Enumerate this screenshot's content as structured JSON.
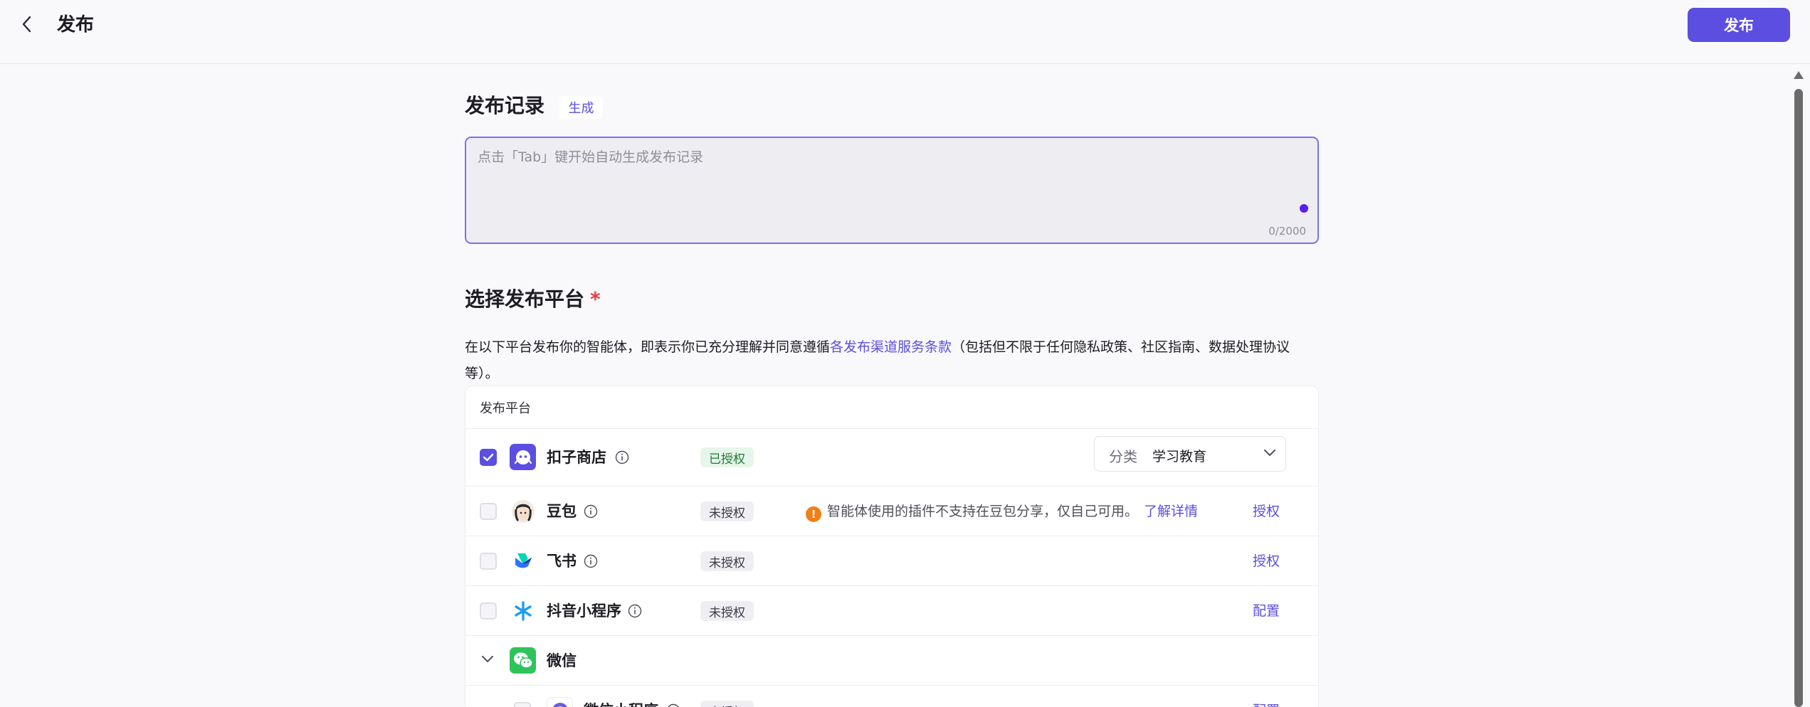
{
  "header": {
    "title": "发布",
    "publish_label": "发布"
  },
  "record": {
    "title": "发布记录",
    "generate_label": "生成",
    "placeholder": "点击「Tab」键开始自动生成发布记录",
    "counter": "0/2000"
  },
  "platform_section": {
    "title": "选择发布平台",
    "required": "*",
    "desc_before": "在以下平台发布你的智能体，即表示你已充分理解并同意遵循",
    "desc_link": "各发布渠道服务条款",
    "desc_after": "（包括但不限于任何隐私政策、社区指南、数据处理协议等）。"
  },
  "table": {
    "header": "发布平台",
    "rows": [
      {
        "name": "扣子商店",
        "status": "已授权",
        "checked": true,
        "icon": "coze-store-icon",
        "category_label": "分类",
        "category_value": "学习教育"
      },
      {
        "name": "豆包",
        "status": "未授权",
        "checked": false,
        "icon": "doubao-icon",
        "warning": "智能体使用的插件不支持在豆包分享，仅自己可用。",
        "warning_link": "了解详情",
        "action": "授权"
      },
      {
        "name": "飞书",
        "status": "未授权",
        "checked": false,
        "icon": "feishu-icon",
        "action": "授权"
      },
      {
        "name": "抖音小程序",
        "status": "未授权",
        "checked": false,
        "icon": "douyin-mini-program-icon",
        "action": "配置"
      },
      {
        "name": "微信",
        "icon": "wechat-icon"
      },
      {
        "name": "微信小程序",
        "status": "未授权",
        "checked": false,
        "icon": "wechat-mini-program-icon",
        "action": "配置"
      }
    ]
  },
  "colors": {
    "accent": "#5b4ee0",
    "authorized_bg": "#e6f6ea",
    "warning": "#f07f14"
  }
}
